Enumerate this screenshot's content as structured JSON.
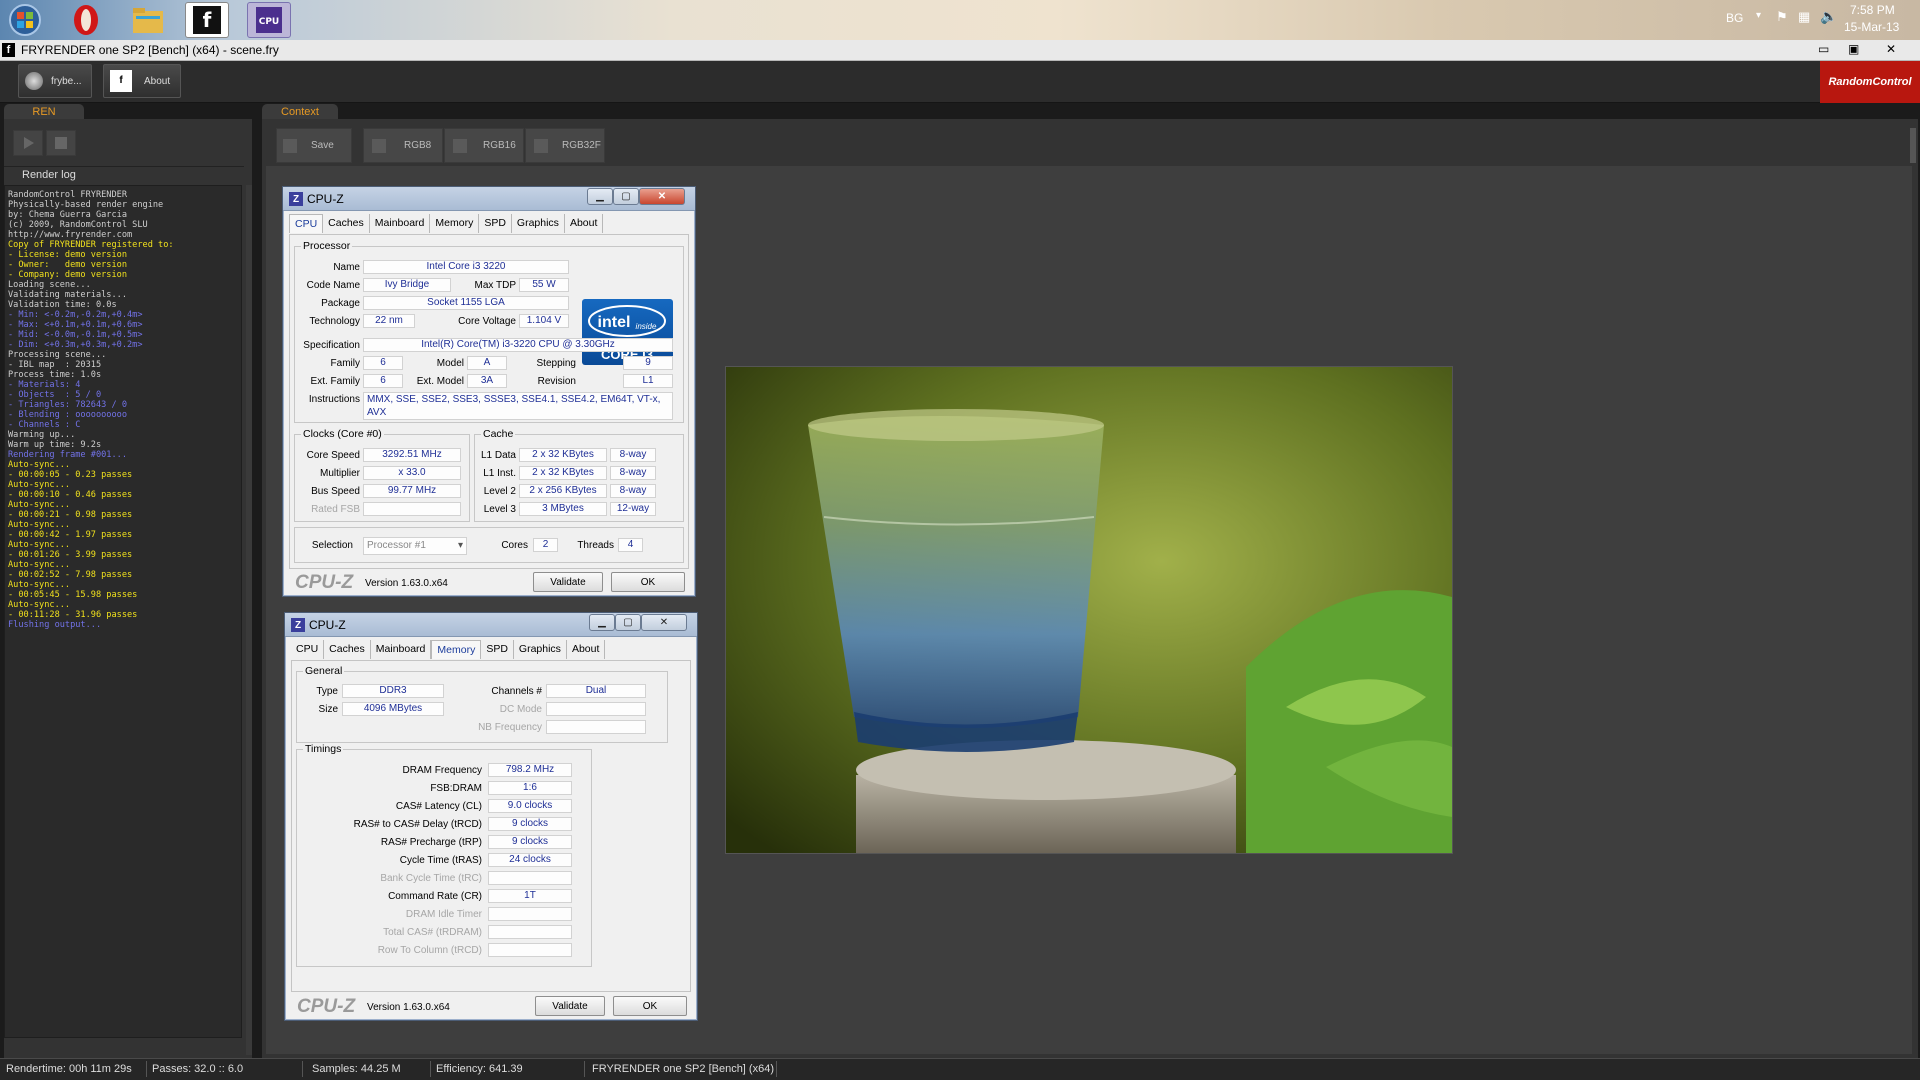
{
  "taskbar": {
    "items": [
      "windows-start",
      "opera",
      "file-explorer",
      "fryrender",
      "cpu-z"
    ],
    "tray": {
      "lang": "BG",
      "time": "7:58 PM",
      "date": "15-Mar-13"
    }
  },
  "window": {
    "title": "FRYRENDER one SP2 [Bench] (x64) - scene.fry"
  },
  "toolbar": {
    "btn1": "frybe...",
    "btn2": "About",
    "brand": "RandomControl"
  },
  "left": {
    "tab": "REN",
    "log_title": "Render log",
    "log": [
      {
        "c": "w",
        "t": "RandomControl FRYRENDER"
      },
      {
        "c": "w",
        "t": "Physically-based render engine"
      },
      {
        "c": "w",
        "t": "by: Chema Guerra Garcia"
      },
      {
        "c": "w",
        "t": "(c) 2009, RandomControl SLU"
      },
      {
        "c": "w",
        "t": "http://www.fryrender.com"
      },
      {
        "c": "w",
        "t": ""
      },
      {
        "c": "y",
        "t": "Copy of FRYRENDER registered to:"
      },
      {
        "c": "w",
        "t": ""
      },
      {
        "c": "y",
        "t": "- License: demo version"
      },
      {
        "c": "y",
        "t": "- Owner:   demo version"
      },
      {
        "c": "y",
        "t": "- Company: demo version"
      },
      {
        "c": "w",
        "t": ""
      },
      {
        "c": "w",
        "t": "Loading scene..."
      },
      {
        "c": "w",
        "t": ""
      },
      {
        "c": "w",
        "t": "Validating materials..."
      },
      {
        "c": "w",
        "t": "Validation time: 0.0s"
      },
      {
        "c": "w",
        "t": ""
      },
      {
        "c": "b",
        "t": "- Min: <-0.2m,-0.2m,+0.4m>"
      },
      {
        "c": "b",
        "t": "- Max: <+0.1m,+0.1m,+0.6m>"
      },
      {
        "c": "b",
        "t": "- Mid: <-0.0m,-0.1m,+0.5m>"
      },
      {
        "c": "b",
        "t": "- Dim: <+0.3m,+0.3m,+0.2m>"
      },
      {
        "c": "w",
        "t": ""
      },
      {
        "c": "w",
        "t": "Processing scene..."
      },
      {
        "c": "w",
        "t": "- IBL map  : 20315"
      },
      {
        "c": "w",
        "t": "Process time: 1.0s"
      },
      {
        "c": "w",
        "t": ""
      },
      {
        "c": "b",
        "t": "- Materials: 4"
      },
      {
        "c": "b",
        "t": "- Objects  : 5 / 0"
      },
      {
        "c": "b",
        "t": "- Triangles: 782643 / 0"
      },
      {
        "c": "b",
        "t": "- Blending : oooooooooo"
      },
      {
        "c": "b",
        "t": "- Channels : C"
      },
      {
        "c": "w",
        "t": ""
      },
      {
        "c": "w",
        "t": "Warming up..."
      },
      {
        "c": "w",
        "t": "Warm up time: 9.2s"
      },
      {
        "c": "w",
        "t": ""
      },
      {
        "c": "b",
        "t": "Rendering frame #001..."
      },
      {
        "c": "w",
        "t": ""
      },
      {
        "c": "y",
        "t": "Auto-sync..."
      },
      {
        "c": "y",
        "t": "- 00:00:05 - 0.23 passes"
      },
      {
        "c": "w",
        "t": ""
      },
      {
        "c": "y",
        "t": "Auto-sync..."
      },
      {
        "c": "y",
        "t": "- 00:00:10 - 0.46 passes"
      },
      {
        "c": "w",
        "t": ""
      },
      {
        "c": "y",
        "t": "Auto-sync..."
      },
      {
        "c": "y",
        "t": "- 00:00:21 - 0.98 passes"
      },
      {
        "c": "w",
        "t": ""
      },
      {
        "c": "y",
        "t": "Auto-sync..."
      },
      {
        "c": "y",
        "t": "- 00:00:42 - 1.97 passes"
      },
      {
        "c": "w",
        "t": ""
      },
      {
        "c": "y",
        "t": "Auto-sync..."
      },
      {
        "c": "y",
        "t": "- 00:01:26 - 3.99 passes"
      },
      {
        "c": "w",
        "t": ""
      },
      {
        "c": "y",
        "t": "Auto-sync..."
      },
      {
        "c": "y",
        "t": "- 00:02:52 - 7.98 passes"
      },
      {
        "c": "w",
        "t": ""
      },
      {
        "c": "y",
        "t": "Auto-sync..."
      },
      {
        "c": "y",
        "t": "- 00:05:45 - 15.98 passes"
      },
      {
        "c": "w",
        "t": ""
      },
      {
        "c": "y",
        "t": "Auto-sync..."
      },
      {
        "c": "y",
        "t": "- 00:11:28 - 31.96 passes"
      },
      {
        "c": "w",
        "t": ""
      },
      {
        "c": "b",
        "t": "Flushing output..."
      }
    ]
  },
  "context": {
    "tab": "Context",
    "buttons": [
      "Save",
      "RGB8",
      "RGB16",
      "RGB32F"
    ]
  },
  "status": {
    "rendertime": "Rendertime: 00h 11m 29s",
    "passes": "Passes: 32.0 :: 6.0",
    "samples": "Samples: 44.25 M",
    "efficiency": "Efficiency: 641.39",
    "app": "FRYRENDER one SP2 [Bench] (x64)"
  },
  "cpuz_cpu": {
    "title": "CPU-Z",
    "tabs": [
      "CPU",
      "Caches",
      "Mainboard",
      "Memory",
      "SPD",
      "Graphics",
      "About"
    ],
    "active_tab": "CPU",
    "processor_label": "Processor",
    "labels": {
      "name": "Name",
      "codename": "Code Name",
      "maxtdp": "Max TDP",
      "package": "Package",
      "technology": "Technology",
      "corevoltage": "Core Voltage",
      "specification": "Specification",
      "family": "Family",
      "model": "Model",
      "stepping": "Stepping",
      "extfamily": "Ext. Family",
      "extmodel": "Ext. Model",
      "revision": "Revision",
      "instructions": "Instructions"
    },
    "values": {
      "name": "Intel Core i3 3220",
      "codename": "Ivy Bridge",
      "maxtdp": "55 W",
      "package": "Socket 1155 LGA",
      "technology": "22 nm",
      "corevoltage": "1.104 V",
      "specification": "Intel(R) Core(TM) i3-3220 CPU @ 3.30GHz",
      "family": "6",
      "model": "A",
      "stepping": "9",
      "extfamily": "6",
      "extmodel": "3A",
      "revision": "L1",
      "instructions": "MMX, SSE, SSE2, SSE3, SSSE3, SSE4.1, SSE4.2, EM64T, VT-x, AVX"
    },
    "clocks": {
      "label": "Clocks (Core #0)",
      "core_speed_l": "Core Speed",
      "core_speed": "3292.51 MHz",
      "multiplier_l": "Multiplier",
      "multiplier": "x 33.0",
      "bus_speed_l": "Bus Speed",
      "bus_speed": "99.77 MHz",
      "rated_fsb_l": "Rated FSB",
      "rated_fsb": ""
    },
    "cache": {
      "label": "Cache",
      "rows": [
        {
          "name": "L1 Data",
          "size": "2 x 32 KBytes",
          "way": "8-way"
        },
        {
          "name": "L1 Inst.",
          "size": "2 x 32 KBytes",
          "way": "8-way"
        },
        {
          "name": "Level 2",
          "size": "2 x 256 KBytes",
          "way": "8-way"
        },
        {
          "name": "Level 3",
          "size": "3 MBytes",
          "way": "12-way"
        }
      ]
    },
    "selection_l": "Selection",
    "selection": "Processor #1",
    "cores_l": "Cores",
    "cores": "2",
    "threads_l": "Threads",
    "threads": "4",
    "intel_inside": "intel",
    "intel_sub": "inside",
    "intel_core": "CORE i3",
    "brand": "CPU-Z",
    "version": "Version 1.63.0.x64",
    "validate": "Validate",
    "ok": "OK"
  },
  "cpuz_mem": {
    "title": "CPU-Z",
    "tabs": [
      "CPU",
      "Caches",
      "Mainboard",
      "Memory",
      "SPD",
      "Graphics",
      "About"
    ],
    "active_tab": "Memory",
    "general_l": "General",
    "type_l": "Type",
    "type": "DDR3",
    "size_l": "Size",
    "size": "4096 MBytes",
    "channels_l": "Channels #",
    "channels": "Dual",
    "dcmode_l": "DC Mode",
    "dcmode": "",
    "nbfreq_l": "NB Frequency",
    "nbfreq": "",
    "timings_l": "Timings",
    "timings": [
      {
        "l": "DRAM Frequency",
        "v": "798.2 MHz",
        "dis": false
      },
      {
        "l": "FSB:DRAM",
        "v": "1:6",
        "dis": false
      },
      {
        "l": "CAS# Latency (CL)",
        "v": "9.0 clocks",
        "dis": false
      },
      {
        "l": "RAS# to CAS# Delay (tRCD)",
        "v": "9 clocks",
        "dis": false
      },
      {
        "l": "RAS# Precharge (tRP)",
        "v": "9 clocks",
        "dis": false
      },
      {
        "l": "Cycle Time (tRAS)",
        "v": "24 clocks",
        "dis": false
      },
      {
        "l": "Bank Cycle Time (tRC)",
        "v": "",
        "dis": true
      },
      {
        "l": "Command Rate (CR)",
        "v": "1T",
        "dis": false
      },
      {
        "l": "DRAM Idle Timer",
        "v": "",
        "dis": true
      },
      {
        "l": "Total CAS# (tRDRAM)",
        "v": "",
        "dis": true
      },
      {
        "l": "Row To Column (tRCD)",
        "v": "",
        "dis": true
      }
    ],
    "brand": "CPU-Z",
    "version": "Version 1.63.0.x64",
    "validate": "Validate",
    "ok": "OK"
  }
}
